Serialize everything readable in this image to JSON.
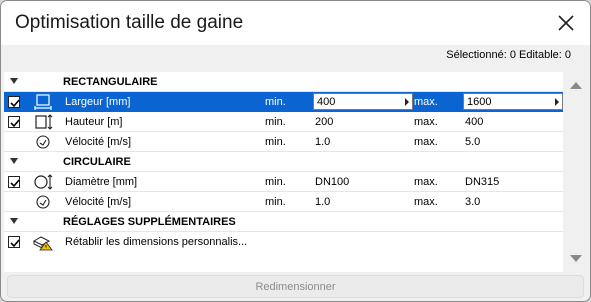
{
  "window": {
    "title": "Optimisation taille de gaine"
  },
  "selection_info": "Sélectionné: 0 Editable: 0",
  "categories": {
    "rect": "RECTANGULAIRE",
    "circ": "CIRCULAIRE",
    "extra": "RÉGLAGES SUPPLÉMENTAIRES"
  },
  "rows": {
    "largeur": {
      "label": "Largeur [mm]",
      "min_label": "min.",
      "min": "400",
      "max_label": "max.",
      "max": "1600"
    },
    "hauteur": {
      "label": "Hauteur [m]",
      "min_label": "min.",
      "min": "200",
      "max_label": "max.",
      "max": "400"
    },
    "velocite_rect": {
      "label": "Vélocité [m/s]",
      "min_label": "min.",
      "min": "1.0",
      "max_label": "max.",
      "max": "5.0"
    },
    "diametre": {
      "label": "Diamètre [mm]",
      "min_label": "min.",
      "min": "DN100",
      "max_label": "max.",
      "max": "DN315"
    },
    "velocite_circ": {
      "label": "Vélocité [m/s]",
      "min_label": "min.",
      "min": "1.0",
      "max_label": "max.",
      "max": "3.0"
    },
    "retablir": {
      "label": "Rétablir les dimensions personnalis..."
    }
  },
  "resize_button": "Redimensionner",
  "colors": {
    "selection": "#0a64d2",
    "background": "#f0f0f0"
  }
}
